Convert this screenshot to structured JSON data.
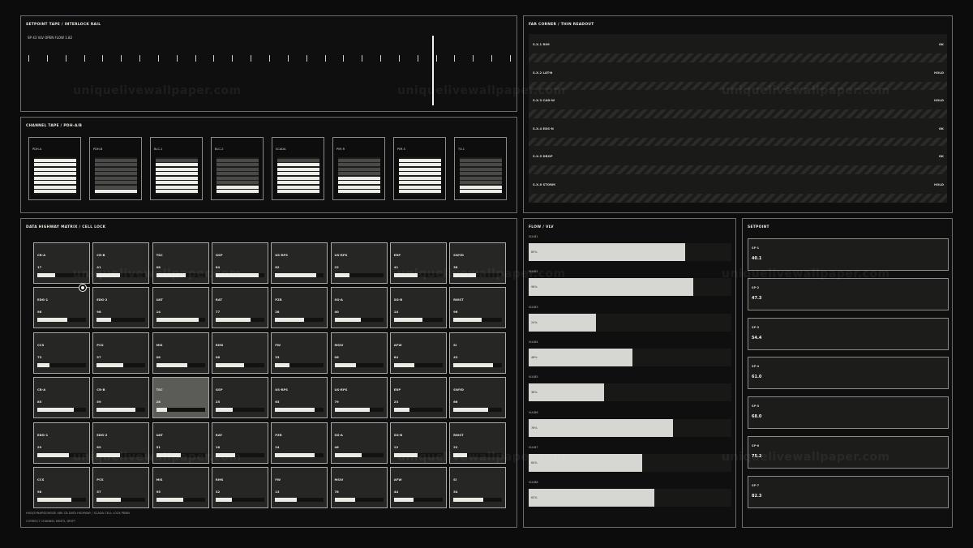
{
  "setpoint_tape": {
    "title": "SETPOINT TAPE  /  INTERLOCK RAIL",
    "readout": "SP  43  VLV OPEN  FLOW 1.82"
  },
  "channel_tape": {
    "title": "CHANNEL TAPE  /  PDH-A/B",
    "channels": [
      {
        "label": "PDH-A",
        "on": [
          1,
          1,
          1,
          1,
          1,
          1,
          1,
          1
        ]
      },
      {
        "label": "PDH-B",
        "on": [
          0,
          0,
          0,
          0,
          0,
          0,
          0,
          1
        ]
      },
      {
        "label": "BLC-1",
        "on": [
          0,
          1,
          1,
          1,
          1,
          1,
          1,
          1
        ]
      },
      {
        "label": "BLC-2",
        "on": [
          0,
          0,
          0,
          0,
          0,
          0,
          1,
          1
        ]
      },
      {
        "label": "SCADA",
        "on": [
          0,
          1,
          1,
          1,
          1,
          1,
          1,
          1
        ]
      },
      {
        "label": "PIM-R",
        "on": [
          0,
          0,
          0,
          0,
          1,
          1,
          1,
          1
        ]
      },
      {
        "label": "PIM-S",
        "on": [
          1,
          1,
          1,
          1,
          1,
          1,
          1,
          1
        ]
      },
      {
        "label": "TV-1",
        "on": [
          0,
          0,
          0,
          0,
          0,
          0,
          1,
          1
        ]
      }
    ]
  },
  "far_corner": {
    "title": "FAR CORNER  /  THIN READOUT",
    "rows": [
      {
        "label": "S.X.1  RIM",
        "state": "OK"
      },
      {
        "label": "S.X.2  LAT-N",
        "state": "HOLD"
      },
      {
        "label": "S.X.3  CAD-W",
        "state": "HOLD"
      },
      {
        "label": "S.X.4  EDS-N",
        "state": "OK"
      },
      {
        "label": "S.X.5  DROP",
        "state": "OK"
      },
      {
        "label": "S.X.6  STORM",
        "state": "HOLD"
      }
    ]
  },
  "matrix": {
    "title": "DATA HIGHWAY MATRIX  /  CELL LOCK",
    "footnote_1": "HUD/SYNAPSE/NODE  48K CB  DATA HIGHWAY / SCADA CELL LOCK  PBNN",
    "footnote_2": "CORRECT CHANNEL MINTS, DRIFT",
    "rows": [
      [
        {
          "name": "CR-A",
          "value": "17",
          "fill": 0.36
        },
        {
          "name": "CR-B",
          "value": "41",
          "fill": 0.48
        },
        {
          "name": "TSC",
          "value": "08",
          "fill": 0.6
        },
        {
          "name": "GSP",
          "value": "84",
          "fill": 0.88
        },
        {
          "name": "US-RPS",
          "value": "82",
          "fill": 0.85
        },
        {
          "name": "US-RPS",
          "value": "22",
          "fill": 0.3
        },
        {
          "name": "ERP",
          "value": "41",
          "fill": 0.48
        },
        {
          "name": "SWYD",
          "value": "38",
          "fill": 0.46
        }
      ],
      [
        {
          "name": "EDG-1",
          "value": "98",
          "fill": 0.62
        },
        {
          "name": "EDG-2",
          "value": "98",
          "fill": 0.3
        },
        {
          "name": "UAT",
          "value": "14",
          "fill": 0.88
        },
        {
          "name": "RAT",
          "value": "77",
          "fill": 0.72
        },
        {
          "name": "PZR",
          "value": "28",
          "fill": 0.6
        },
        {
          "name": "SG-A",
          "value": "40",
          "fill": 0.54
        },
        {
          "name": "SG-B",
          "value": "14",
          "fill": 0.58
        },
        {
          "name": "RWST",
          "value": "96",
          "fill": 0.58
        }
      ],
      [
        {
          "name": "CCS",
          "value": "73",
          "fill": 0.25
        },
        {
          "name": "PCS",
          "value": "57",
          "fill": 0.55
        },
        {
          "name": "MIS",
          "value": "08",
          "fill": 0.64
        },
        {
          "name": "RMS",
          "value": "08",
          "fill": 0.58
        },
        {
          "name": "FW",
          "value": "33",
          "fill": 0.3
        },
        {
          "name": "MSIV",
          "value": "06",
          "fill": 0.44
        },
        {
          "name": "AFW",
          "value": "84",
          "fill": 0.42
        },
        {
          "name": "SI",
          "value": "43",
          "fill": 0.82
        }
      ],
      [
        {
          "name": "CR-A",
          "value": "65",
          "fill": 0.75
        },
        {
          "name": "CR-B",
          "value": "59",
          "fill": 0.8
        },
        {
          "name": "TSC",
          "value": "28",
          "fill": 0.22
        },
        {
          "name": "GSP",
          "value": "25",
          "fill": 0.35
        },
        {
          "name": "US-RPS",
          "value": "63",
          "fill": 0.82
        },
        {
          "name": "US-RPS",
          "value": "79",
          "fill": 0.72
        },
        {
          "name": "ERP",
          "value": "23",
          "fill": 0.32
        },
        {
          "name": "SWYD",
          "value": "66",
          "fill": 0.72
        }
      ],
      [
        {
          "name": "EDG-1",
          "value": "29",
          "fill": 0.65
        },
        {
          "name": "EDG-2",
          "value": "89",
          "fill": 0.48
        },
        {
          "name": "UAT",
          "value": "51",
          "fill": 0.5
        },
        {
          "name": "RAT",
          "value": "18",
          "fill": 0.4
        },
        {
          "name": "PZR",
          "value": "24",
          "fill": 0.82
        },
        {
          "name": "SG-A",
          "value": "46",
          "fill": 0.55
        },
        {
          "name": "SG-B",
          "value": "12",
          "fill": 0.48
        },
        {
          "name": "RWST",
          "value": "22",
          "fill": 0.28
        }
      ],
      [
        {
          "name": "CCS",
          "value": "98",
          "fill": 0.7
        },
        {
          "name": "PCS",
          "value": "57",
          "fill": 0.5
        },
        {
          "name": "MIS",
          "value": "95",
          "fill": 0.56
        },
        {
          "name": "RMS",
          "value": "32",
          "fill": 0.34
        },
        {
          "name": "FW",
          "value": "13",
          "fill": 0.45
        },
        {
          "name": "MSIV",
          "value": "78",
          "fill": 0.43
        },
        {
          "name": "AFW",
          "value": "44",
          "fill": 0.4
        },
        {
          "name": "SI",
          "value": "54",
          "fill": 0.62
        }
      ]
    ],
    "highlight": {
      "row": 3,
      "col": 2
    }
  },
  "flow": {
    "title": "FLOW  /  VLV",
    "valves": [
      {
        "tag": "VLV-B1",
        "pct": "85%",
        "fill": 0.77
      },
      {
        "tag": "VLV-B2",
        "pct": "96%",
        "fill": 0.81
      },
      {
        "tag": "VLV-B3",
        "pct": "24%",
        "fill": 0.33
      },
      {
        "tag": "VLV-B4",
        "pct": "48%",
        "fill": 0.51
      },
      {
        "tag": "VLV-B5",
        "pct": "38%",
        "fill": 0.37
      },
      {
        "tag": "VLV-B6",
        "pct": "76%",
        "fill": 0.71
      },
      {
        "tag": "VLV-B7",
        "pct": "64%",
        "fill": 0.56
      },
      {
        "tag": "VLV-B8",
        "pct": "63%",
        "fill": 0.62
      }
    ]
  },
  "setpoint": {
    "title": "SETPOINT",
    "items": [
      {
        "label": "SP-1",
        "value": "40.1"
      },
      {
        "label": "SP-2",
        "value": "47.3"
      },
      {
        "label": "SP-3",
        "value": "54.4"
      },
      {
        "label": "SP-4",
        "value": "61.0"
      },
      {
        "label": "SP-5",
        "value": "68.0"
      },
      {
        "label": "SP-6",
        "value": "75.2"
      },
      {
        "label": "SP-7",
        "value": "82.3"
      }
    ]
  },
  "watermark": "uniquelivewallpaper.com"
}
